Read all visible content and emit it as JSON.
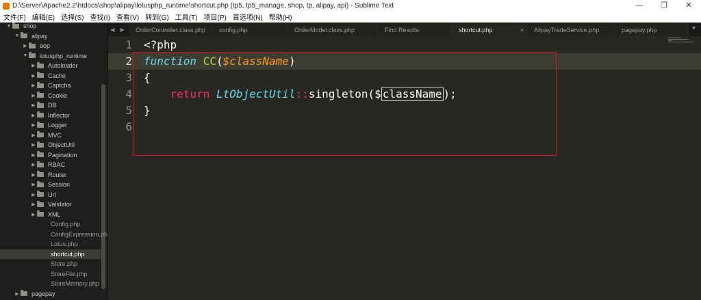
{
  "window": {
    "title": "D:\\Server\\Apache2.2\\htdocs\\shop\\alipay\\lotusphp_runtime\\shortcut.php (tp5, tp5_manage, shop, tp, alipay, api) - Sublime Text",
    "minimize_glyph": "—",
    "restore_glyph": "❐",
    "close_glyph": "✕"
  },
  "menu": [
    {
      "label": "文件(F)"
    },
    {
      "label": "编辑(E)"
    },
    {
      "label": "选择(S)"
    },
    {
      "label": "查找(I)"
    },
    {
      "label": "查看(V)"
    },
    {
      "label": "转到(G)"
    },
    {
      "label": "工具(T)"
    },
    {
      "label": "项目(P)"
    },
    {
      "label": "首选项(N)"
    },
    {
      "label": "帮助(H)"
    }
  ],
  "sidebar": {
    "items": [
      {
        "label": "shop",
        "type": "folder",
        "expanded": true,
        "depth": 0
      },
      {
        "label": "alipay",
        "type": "folder",
        "expanded": true,
        "depth": 1
      },
      {
        "label": "aop",
        "type": "folder",
        "expanded": false,
        "depth": 2
      },
      {
        "label": "lotusphp_runtime",
        "type": "folder",
        "expanded": true,
        "depth": 2
      },
      {
        "label": "Autoloader",
        "type": "folder",
        "expanded": false,
        "depth": 3
      },
      {
        "label": "Cache",
        "type": "folder",
        "expanded": false,
        "depth": 3
      },
      {
        "label": "Captcha",
        "type": "folder",
        "expanded": false,
        "depth": 3
      },
      {
        "label": "Cookie",
        "type": "folder",
        "expanded": false,
        "depth": 3
      },
      {
        "label": "DB",
        "type": "folder",
        "expanded": false,
        "depth": 3
      },
      {
        "label": "Inflector",
        "type": "folder",
        "expanded": false,
        "depth": 3
      },
      {
        "label": "Logger",
        "type": "folder",
        "expanded": false,
        "depth": 3
      },
      {
        "label": "MVC",
        "type": "folder",
        "expanded": false,
        "depth": 3
      },
      {
        "label": "ObjectUtil",
        "type": "folder",
        "expanded": false,
        "depth": 3
      },
      {
        "label": "Pagination",
        "type": "folder",
        "expanded": false,
        "depth": 3
      },
      {
        "label": "RBAC",
        "type": "folder",
        "expanded": false,
        "depth": 3
      },
      {
        "label": "Router",
        "type": "folder",
        "expanded": false,
        "depth": 3
      },
      {
        "label": "Session",
        "type": "folder",
        "expanded": false,
        "depth": 3
      },
      {
        "label": "Url",
        "type": "folder",
        "expanded": false,
        "depth": 3
      },
      {
        "label": "Validator",
        "type": "folder",
        "expanded": false,
        "depth": 3
      },
      {
        "label": "XML",
        "type": "folder",
        "expanded": false,
        "depth": 3
      },
      {
        "label": "Config.php",
        "type": "file",
        "depth": 3
      },
      {
        "label": "ConfigExpression.ph",
        "type": "file",
        "depth": 3
      },
      {
        "label": "Lotus.php",
        "type": "file",
        "depth": 3
      },
      {
        "label": "shortcut.php",
        "type": "file",
        "depth": 3,
        "selected": true
      },
      {
        "label": "Store.php",
        "type": "file",
        "depth": 3
      },
      {
        "label": "StoreFile.php",
        "type": "file",
        "depth": 3
      },
      {
        "label": "StoreMemory.php",
        "type": "file",
        "depth": 3
      },
      {
        "label": "pagepay",
        "type": "folder",
        "expanded": false,
        "depth": 1
      }
    ]
  },
  "tabs": {
    "nav_glyph": "◀ ▶",
    "overflow_glyph": "▾",
    "close_glyph": "✕",
    "items": [
      {
        "label": "OrderController.class.php",
        "active": false
      },
      {
        "label": "config.php",
        "active": false
      },
      {
        "label": "OrderModel.class.php",
        "active": false
      },
      {
        "label": "Find Results",
        "active": false
      },
      {
        "label": "shortcut.php",
        "active": true
      },
      {
        "label": "AlipayTradeService.php",
        "active": false
      },
      {
        "label": "pagepay.php",
        "active": false
      }
    ]
  },
  "editor": {
    "current_line": 2,
    "line_numbers": [
      "1",
      "2",
      "3",
      "4",
      "5",
      "6"
    ],
    "code": {
      "l1": "<?php",
      "l2_kw": "function",
      "l2_fn": "CC",
      "l2_open": "(",
      "l2_param": "$className",
      "l2_close": ")",
      "l3": "{",
      "l4_indent": "    ",
      "l4_kw": "return",
      "l4_cls": "LtObjectUtil",
      "l4_op": "::",
      "l4_meth": "singleton",
      "l4_open": "($",
      "l4_var": "className",
      "l4_close": ");",
      "l5": "}"
    }
  },
  "colors": {
    "background": "#272822",
    "annotation_border": "#d9141e",
    "keyword_function": "#66d9ef",
    "function_name": "#a6e22e",
    "parameter": "#fd971f",
    "keyword_return": "#f92672"
  }
}
